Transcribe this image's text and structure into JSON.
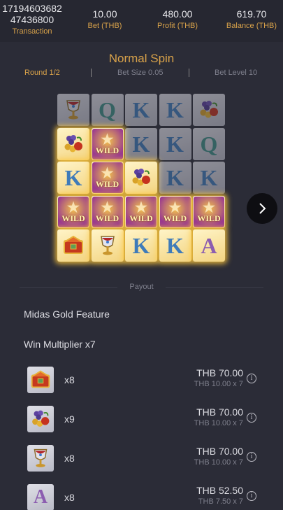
{
  "header": {
    "transaction_id": "17194603682\n47436800",
    "transaction_label": "Transaction",
    "bet_value": "10.00",
    "bet_label": "Bet (THB)",
    "profit_value": "480.00",
    "profit_label": "Profit (THB)",
    "balance_value": "619.70",
    "balance_label": "Balance (THB)"
  },
  "spin": {
    "title": "Normal Spin",
    "round": "Round 1/2",
    "bet_size": "Bet Size 0.05",
    "bet_level": "Bet Level 10"
  },
  "grid": [
    [
      {
        "s": "goblet-icon",
        "w": false
      },
      {
        "s": "Q",
        "w": false
      },
      {
        "s": "K",
        "w": false
      },
      {
        "s": "K",
        "w": false
      },
      {
        "s": "fruit-icon",
        "w": false
      }
    ],
    [
      {
        "s": "fruit-icon",
        "w": true
      },
      {
        "s": "wild-icon",
        "w": true
      },
      {
        "s": "K",
        "w": false
      },
      {
        "s": "K",
        "w": false
      },
      {
        "s": "Q",
        "w": false
      }
    ],
    [
      {
        "s": "K",
        "w": true
      },
      {
        "s": "wild-icon",
        "w": true
      },
      {
        "s": "fruit-icon",
        "w": true
      },
      {
        "s": "K",
        "w": false
      },
      {
        "s": "K",
        "w": false
      }
    ],
    [
      {
        "s": "wild-icon",
        "w": true
      },
      {
        "s": "wild-icon",
        "w": true
      },
      {
        "s": "wild-icon",
        "w": true
      },
      {
        "s": "wild-icon",
        "w": true
      },
      {
        "s": "wild-icon",
        "w": true
      }
    ],
    [
      {
        "s": "chest-icon",
        "w": true
      },
      {
        "s": "goblet-icon",
        "w": true
      },
      {
        "s": "K",
        "w": true
      },
      {
        "s": "K",
        "w": true
      },
      {
        "s": "A",
        "w": true
      }
    ]
  ],
  "wild_text": "WILD",
  "payout_label": "Payout",
  "feature_label": "Midas Gold Feature",
  "multiplier_label": "Win Multiplier x7",
  "payouts": [
    {
      "symbol": "chest-icon",
      "count": "x8",
      "amount": "THB 70.00",
      "calc": "THB 10.00 x 7"
    },
    {
      "symbol": "fruit-icon",
      "count": "x9",
      "amount": "THB 70.00",
      "calc": "THB 10.00 x 7"
    },
    {
      "symbol": "goblet-icon",
      "count": "x8",
      "amount": "THB 70.00",
      "calc": "THB 10.00 x 7"
    },
    {
      "symbol": "A",
      "count": "x8",
      "amount": "THB 52.50",
      "calc": "THB 7.50 x 7"
    }
  ],
  "colors": {
    "accent": "#d8a24a",
    "background": "#2b2c37",
    "header": "#262731"
  }
}
